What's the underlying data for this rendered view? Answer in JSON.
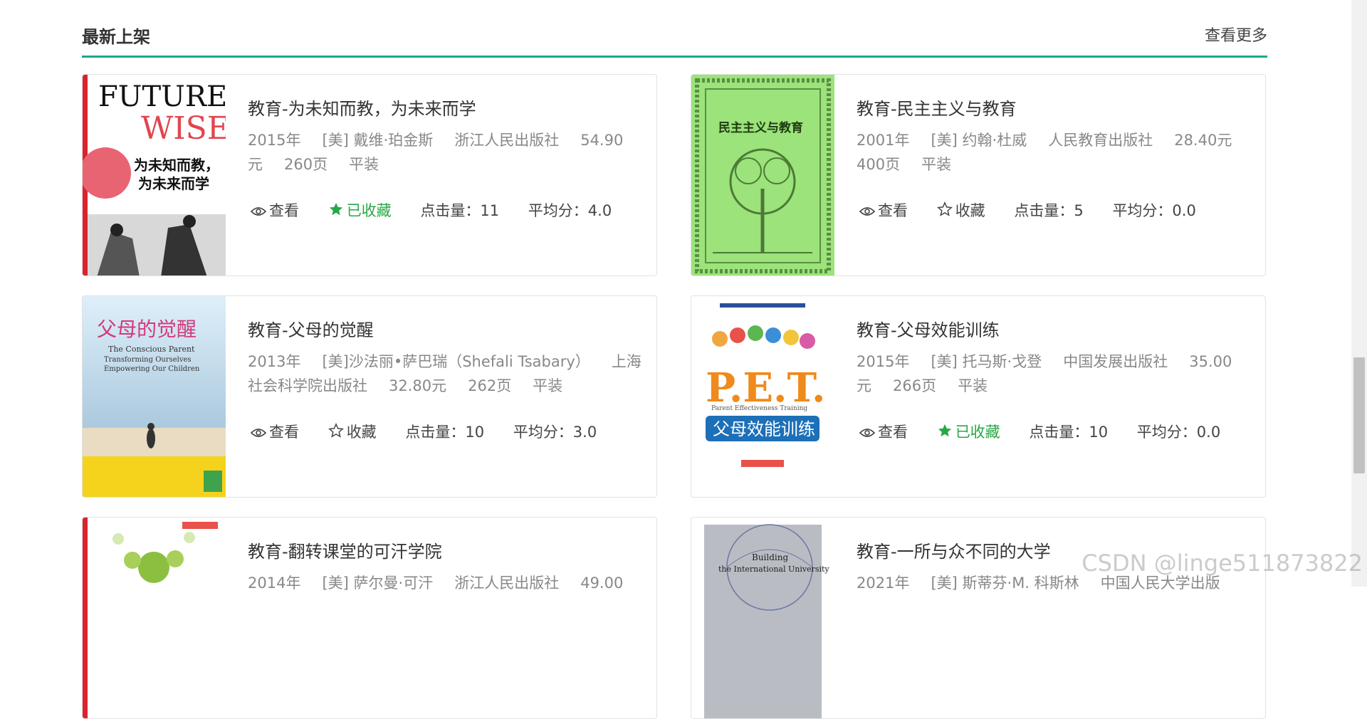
{
  "section": {
    "title": "最新上架",
    "more": "查看更多"
  },
  "labels": {
    "view": "查看",
    "favorited": "已收藏",
    "favorite": "收藏"
  },
  "books": [
    {
      "title": "教育-为未知而教，为未来而学",
      "year": "2015年",
      "author": "[美] 戴维·珀金斯",
      "publisher": "浙江人民出版社",
      "price": "54.90元",
      "pages": "260页",
      "binding": "平装",
      "clicks": "点击量：11",
      "score": "平均分：4.0",
      "favorited": true,
      "cover": {
        "title1": "FUTURE",
        "title2": "WISE",
        "cn1": "为未知而教，",
        "cn2": "为未来而学"
      }
    },
    {
      "title": "教育-民主主义与教育",
      "year": "2001年",
      "author": "[美] 约翰·杜威",
      "publisher": "人民教育出版社",
      "price": "28.40元",
      "pages": "400页",
      "binding": "平装",
      "clicks": "点击量：5",
      "score": "平均分：0.0",
      "favorited": false,
      "cover": {
        "title": "民主主义与教育"
      }
    },
    {
      "title": "教育-父母的觉醒",
      "year": "2013年",
      "author": "[美]沙法丽•萨巴瑞（Shefali Tsabary）",
      "publisher": "上海社会科学院出版社",
      "price": "32.80元",
      "pages": "262页",
      "binding": "平装",
      "clicks": "点击量：10",
      "score": "平均分：3.0",
      "favorited": false,
      "cover": {
        "cn": "父母的觉醒",
        "en1": "The Conscious Parent",
        "en2": "Transforming Ourselves",
        "en3": "Empowering Our Children"
      }
    },
    {
      "title": "教育-父母效能训练",
      "year": "2015年",
      "author": "[美] 托马斯·戈登",
      "publisher": "中国发展出版社",
      "price": "35.00元",
      "pages": "266页",
      "binding": "平装",
      "clicks": "点击量：10",
      "score": "平均分：0.0",
      "favorited": true,
      "cover": {
        "big": "P.E.T.",
        "sub": "Parent   Effectiveness   Training",
        "cn": "父母效能训练"
      }
    },
    {
      "title": "教育-翻转课堂的可汗学院",
      "year": "2014年",
      "author": "[美] 萨尔曼·可汗",
      "publisher": "浙江人民出版社",
      "price": "49.00"
    },
    {
      "title": "教育-一所与众不同的大学",
      "year": "2021年",
      "author": "[美] 斯蒂芬·M. 科斯林",
      "publisher": "中国人民大学出版",
      "cover": {
        "en1": "Building",
        "en2": "the International University"
      }
    }
  ],
  "watermark": "CSDN @linge511873822"
}
